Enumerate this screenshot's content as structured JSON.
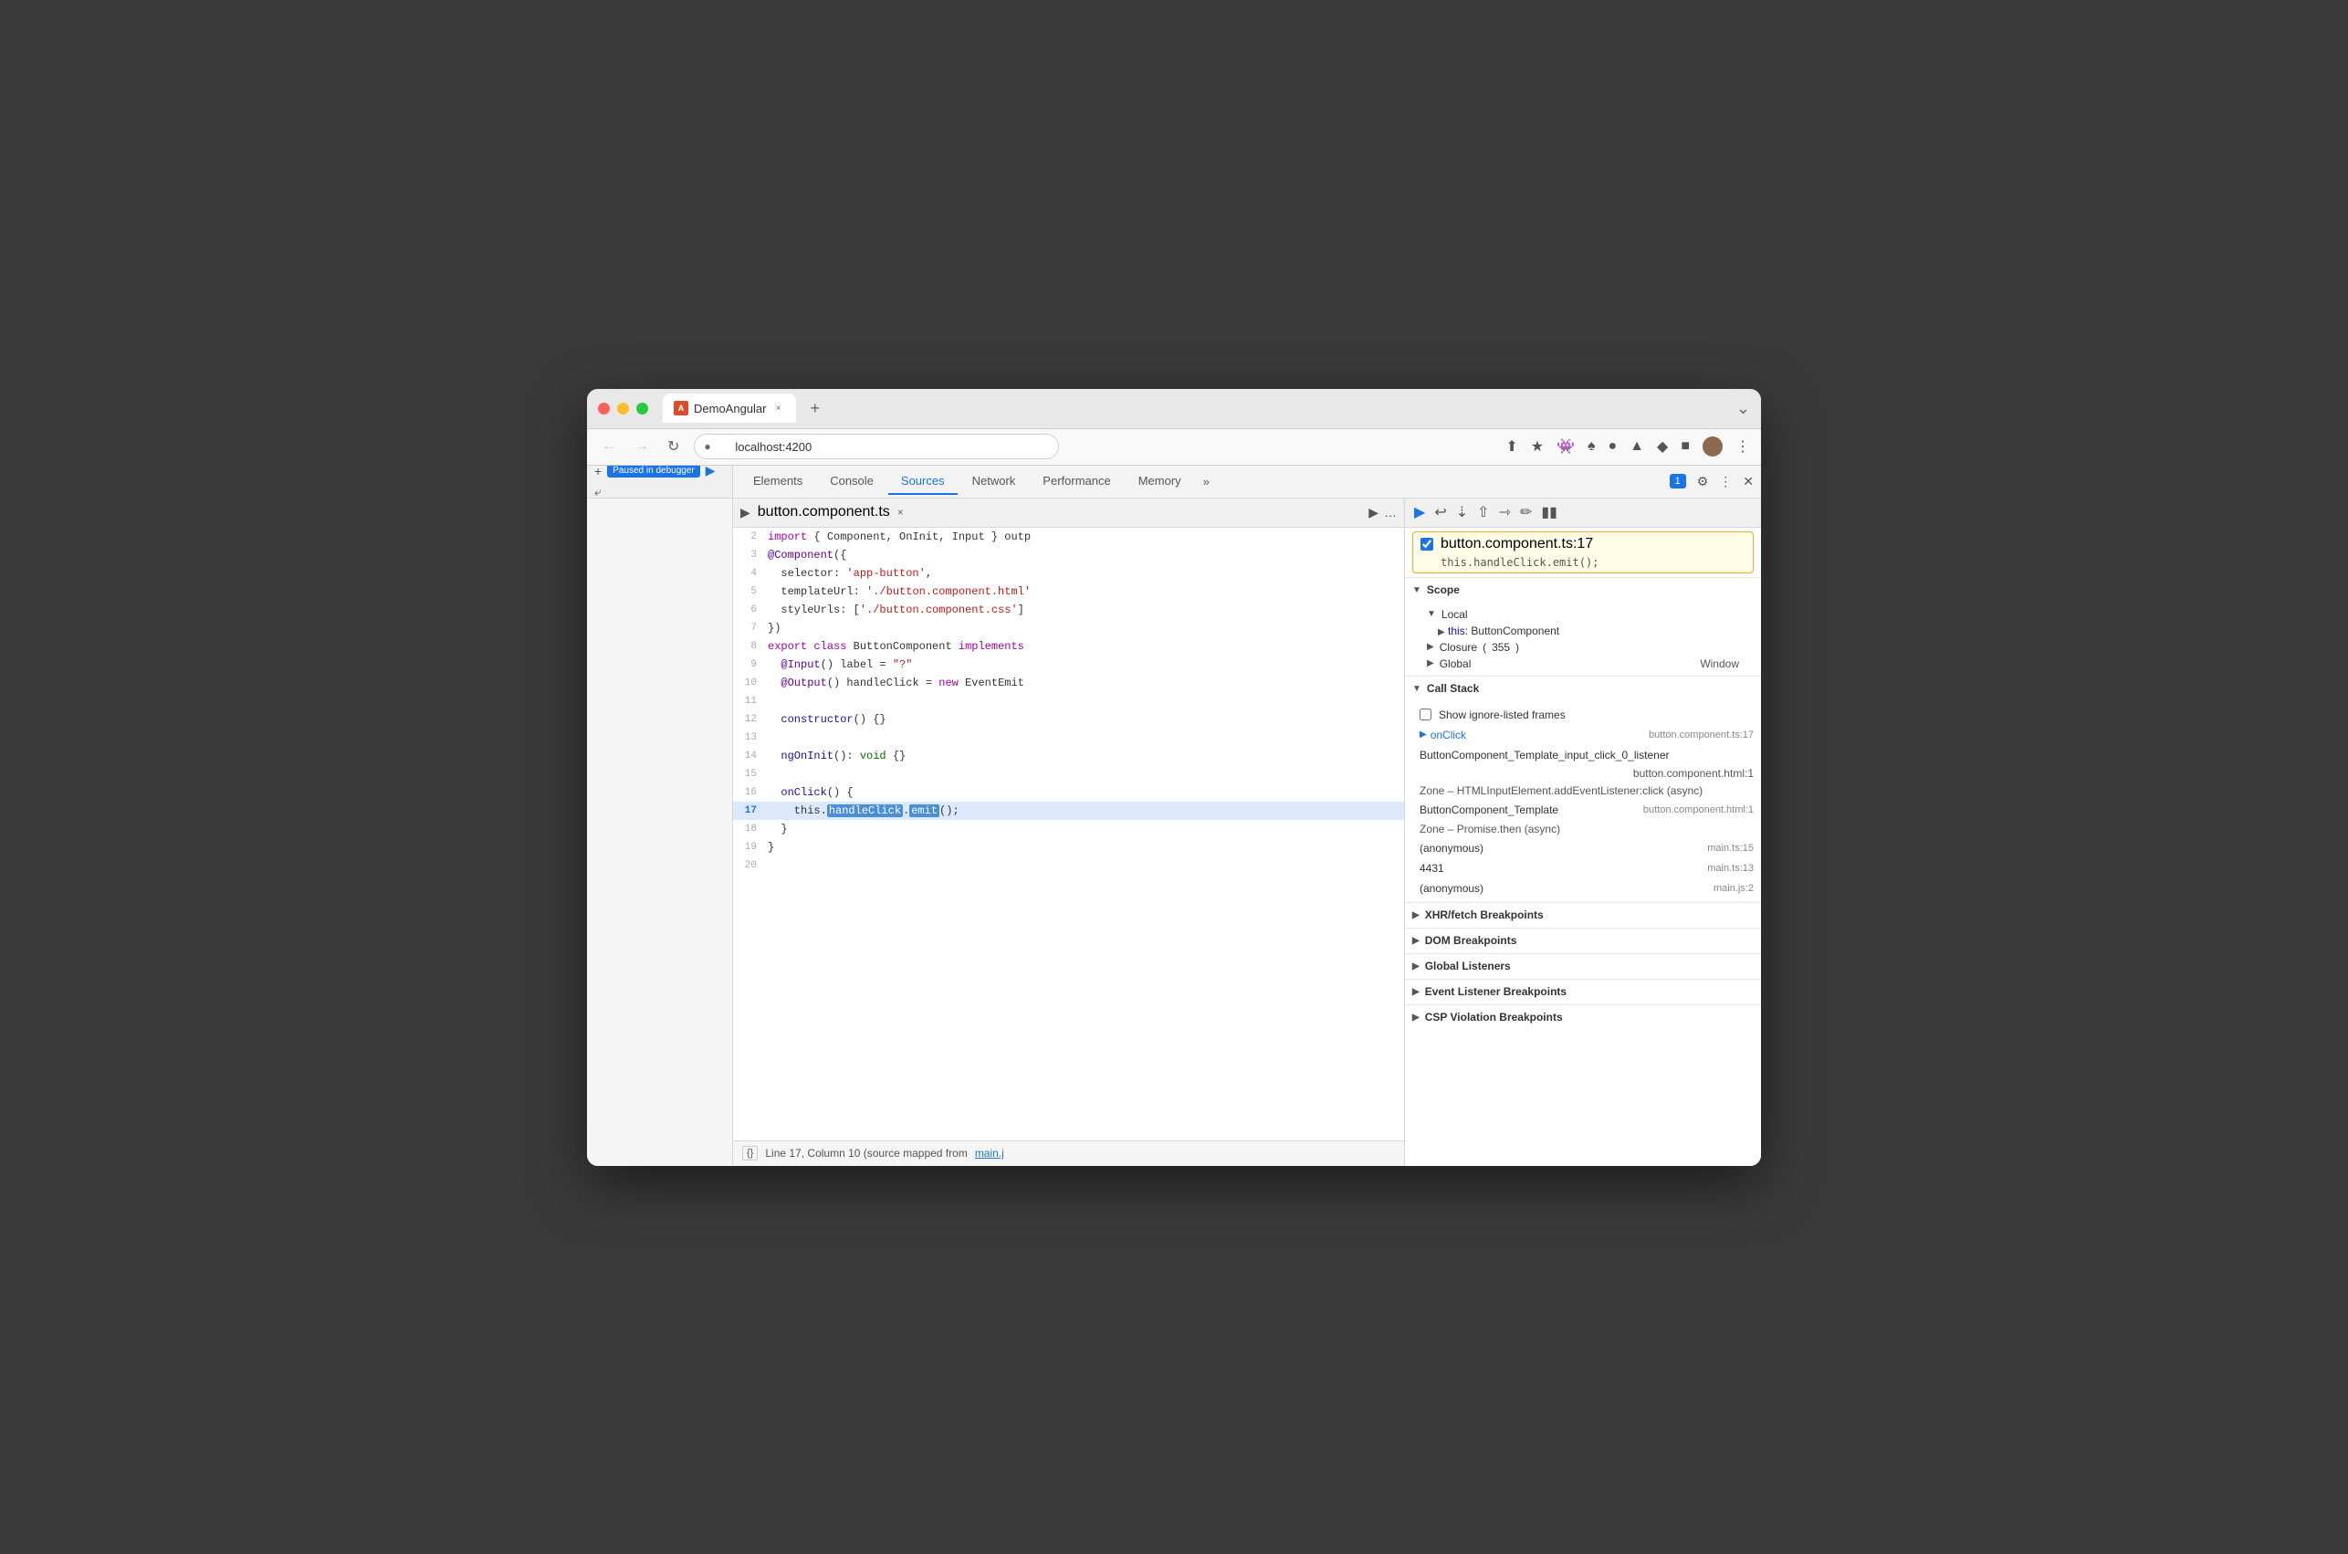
{
  "browser": {
    "tab_title": "DemoAngular",
    "tab_close": "×",
    "tab_add": "+",
    "address": "localhost:4200",
    "window_chevron": "⌄"
  },
  "devtools": {
    "tabs": [
      "Elements",
      "Console",
      "Sources",
      "Network",
      "Performance",
      "Memory"
    ],
    "active_tab": "Sources",
    "more_tabs": "»",
    "notification_count": "1",
    "settings_icon": "⚙",
    "more_icon": "⋮",
    "close_icon": "✕"
  },
  "source_panel": {
    "file_name": "button.component.ts",
    "file_close": "×",
    "status_text": "Line 17, Column 10 (source mapped from",
    "status_link": "main.j",
    "source_icon": "{}"
  },
  "code": {
    "lines": [
      {
        "num": 2,
        "content": "import { Component, OnInit, Input } outp",
        "indent": ""
      },
      {
        "num": 3,
        "content": "@Component({",
        "indent": ""
      },
      {
        "num": 4,
        "content": "  selector: 'app-button',",
        "indent": ""
      },
      {
        "num": 5,
        "content": "  templateUrl: './button.component.html'",
        "indent": ""
      },
      {
        "num": 6,
        "content": "  styleUrls: ['./button.component.css']",
        "indent": ""
      },
      {
        "num": 7,
        "content": "})",
        "indent": ""
      },
      {
        "num": 8,
        "content": "export class ButtonComponent implements",
        "indent": ""
      },
      {
        "num": 9,
        "content": "  @Input() label = \"?\"",
        "indent": ""
      },
      {
        "num": 10,
        "content": "  @Output() handleClick = new EventEmit",
        "indent": ""
      },
      {
        "num": 11,
        "content": "",
        "indent": ""
      },
      {
        "num": 12,
        "content": "  constructor() {}",
        "indent": ""
      },
      {
        "num": 13,
        "content": "",
        "indent": ""
      },
      {
        "num": 14,
        "content": "  ngOnInit(): void {}",
        "indent": ""
      },
      {
        "num": 15,
        "content": "",
        "indent": ""
      },
      {
        "num": 16,
        "content": "  onClick() {",
        "indent": ""
      },
      {
        "num": 17,
        "content": "    this.handleClick.emit();",
        "indent": "",
        "is_current": true
      },
      {
        "num": 18,
        "content": "  }",
        "indent": ""
      },
      {
        "num": 19,
        "content": "}",
        "indent": ""
      },
      {
        "num": 20,
        "content": "",
        "indent": ""
      }
    ]
  },
  "debugger": {
    "pause_label": "Paused in debugger",
    "controls": {
      "resume": "▶",
      "step_over": "↩",
      "step_into": "↓",
      "step_out": "↑",
      "step": "→",
      "deactivate": "✕",
      "pause_async": "⏸"
    }
  },
  "breakpoint": {
    "file_line": "button.component.ts:17",
    "code": "this.handleClick.emit();"
  },
  "scope": {
    "title": "Scope",
    "local_title": "Local",
    "local_this": "this",
    "local_this_val": "ButtonComponent",
    "closure_title": "Closure",
    "closure_num": "355",
    "global_title": "Global",
    "global_val": "Window"
  },
  "call_stack": {
    "title": "Call Stack",
    "show_ignore": "Show ignore-listed frames",
    "frames": [
      {
        "name": "onClick",
        "loc": "button.component.ts:17",
        "active": true
      },
      {
        "name": "ButtonComponent_Template_input_click_0_listener",
        "loc": ""
      },
      {
        "name": "",
        "loc": "button.component.html:1"
      },
      {
        "name": "Zone – HTMLInputElement.addEventListener:click (async)",
        "loc": ""
      },
      {
        "name": "ButtonComponent_Template",
        "loc": "button.component.html:1"
      },
      {
        "name": "Zone – Promise.then (async)",
        "loc": ""
      },
      {
        "name": "(anonymous)",
        "loc": "main.ts:15"
      },
      {
        "name": "4431",
        "loc": "main.ts:13"
      },
      {
        "name": "(anonymous)",
        "loc": "main.js:2"
      }
    ]
  },
  "breakpoints_sections": [
    "XHR/fetch Breakpoints",
    "DOM Breakpoints",
    "Global Listeners",
    "Event Listener Breakpoints",
    "CSP Violation Breakpoints"
  ]
}
